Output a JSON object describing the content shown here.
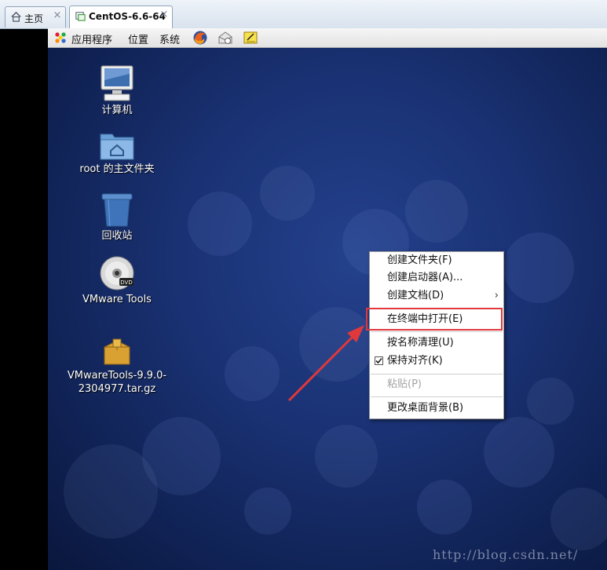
{
  "tabs": [
    {
      "label": "主页",
      "icon": "home-icon",
      "close": "×"
    },
    {
      "label": "CentOS-6.6-64",
      "icon": "vm-icon",
      "close": "×"
    }
  ],
  "panel": {
    "menus": [
      "应用程序",
      "位置",
      "系统"
    ],
    "launchers": [
      "firefox-icon",
      "mail-icon",
      "notes-icon"
    ]
  },
  "desktop_icons": [
    {
      "label": "计算机",
      "icon": "computer-icon"
    },
    {
      "label": "root 的主文件夹",
      "icon": "home-folder-icon"
    },
    {
      "label": "回收站",
      "icon": "trash-icon"
    },
    {
      "label": "VMware Tools",
      "icon": "dvd-icon"
    },
    {
      "label_line1": "VMwareTools-9.9.0-",
      "label_line2": "2304977.tar.gz",
      "icon": "package-icon"
    }
  ],
  "dvd_text": "DVD",
  "context_menu": {
    "items": [
      {
        "label": "创建文件夹(F)"
      },
      {
        "label": "创建启动器(A)..."
      },
      {
        "label": "创建文档(D)",
        "submenu": "›"
      },
      {
        "label": "在终端中打开(E)",
        "highlighted": true
      },
      {
        "label": "按名称清理(U)"
      },
      {
        "label": "保持对齐(K)",
        "checked": true
      },
      {
        "label": "粘贴(P)",
        "disabled": true
      },
      {
        "label": "更改桌面背景(B)"
      }
    ]
  },
  "watermark": "http://blog.csdn.net/",
  "colors": {
    "highlight_box": "#e0383b",
    "annotation_arrow": "#e0383b",
    "desktop_bg": "#1a3274"
  }
}
